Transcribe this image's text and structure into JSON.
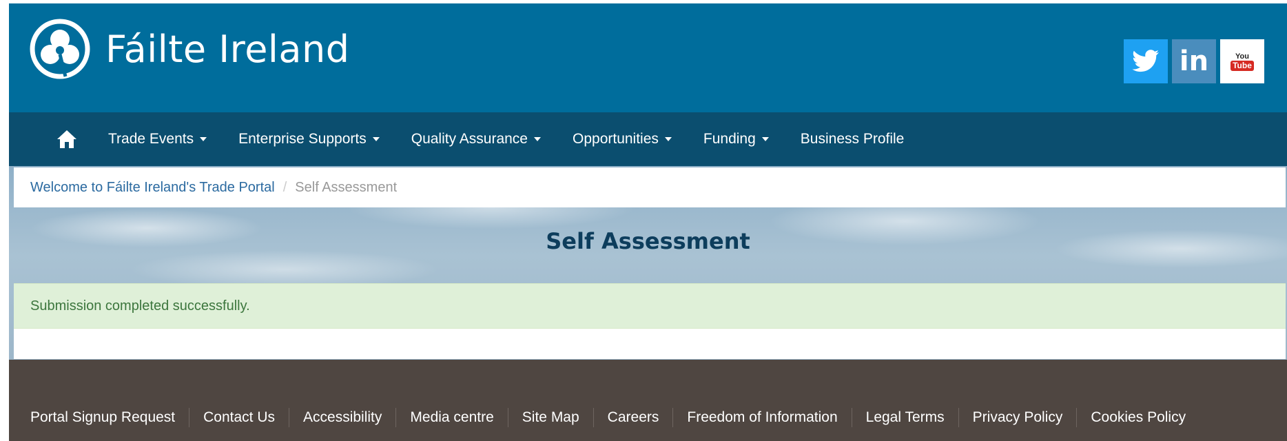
{
  "header": {
    "brand_name": "Fáilte Ireland",
    "social": {
      "linkedin_label": "in",
      "youtube_you": "You",
      "youtube_tube": "Tube"
    }
  },
  "nav": {
    "items": [
      {
        "label": "Trade Events",
        "dropdown": true
      },
      {
        "label": "Enterprise Supports",
        "dropdown": true
      },
      {
        "label": "Quality Assurance",
        "dropdown": true
      },
      {
        "label": "Opportunities",
        "dropdown": true
      },
      {
        "label": "Funding",
        "dropdown": true
      },
      {
        "label": "Business Profile",
        "dropdown": false
      }
    ]
  },
  "breadcrumb": {
    "home_label": "Welcome to Fáilte Ireland's Trade Portal",
    "separator": "/",
    "current": "Self Assessment"
  },
  "page": {
    "title": "Self Assessment"
  },
  "alert": {
    "message": "Submission completed successfully.",
    "color": "#3c763d"
  },
  "footer": {
    "links": [
      "Portal Signup Request",
      "Contact Us",
      "Accessibility",
      "Media centre",
      "Site Map",
      "Careers",
      "Freedom of Information",
      "Legal Terms",
      "Privacy Policy",
      "Cookies Policy"
    ]
  },
  "colors": {
    "header_bg": "#006d9c",
    "nav_bg": "#0b4e6f",
    "footer_bg": "#4f4641",
    "title_color": "#0d3d5c",
    "link_color": "#2b6aa0"
  }
}
